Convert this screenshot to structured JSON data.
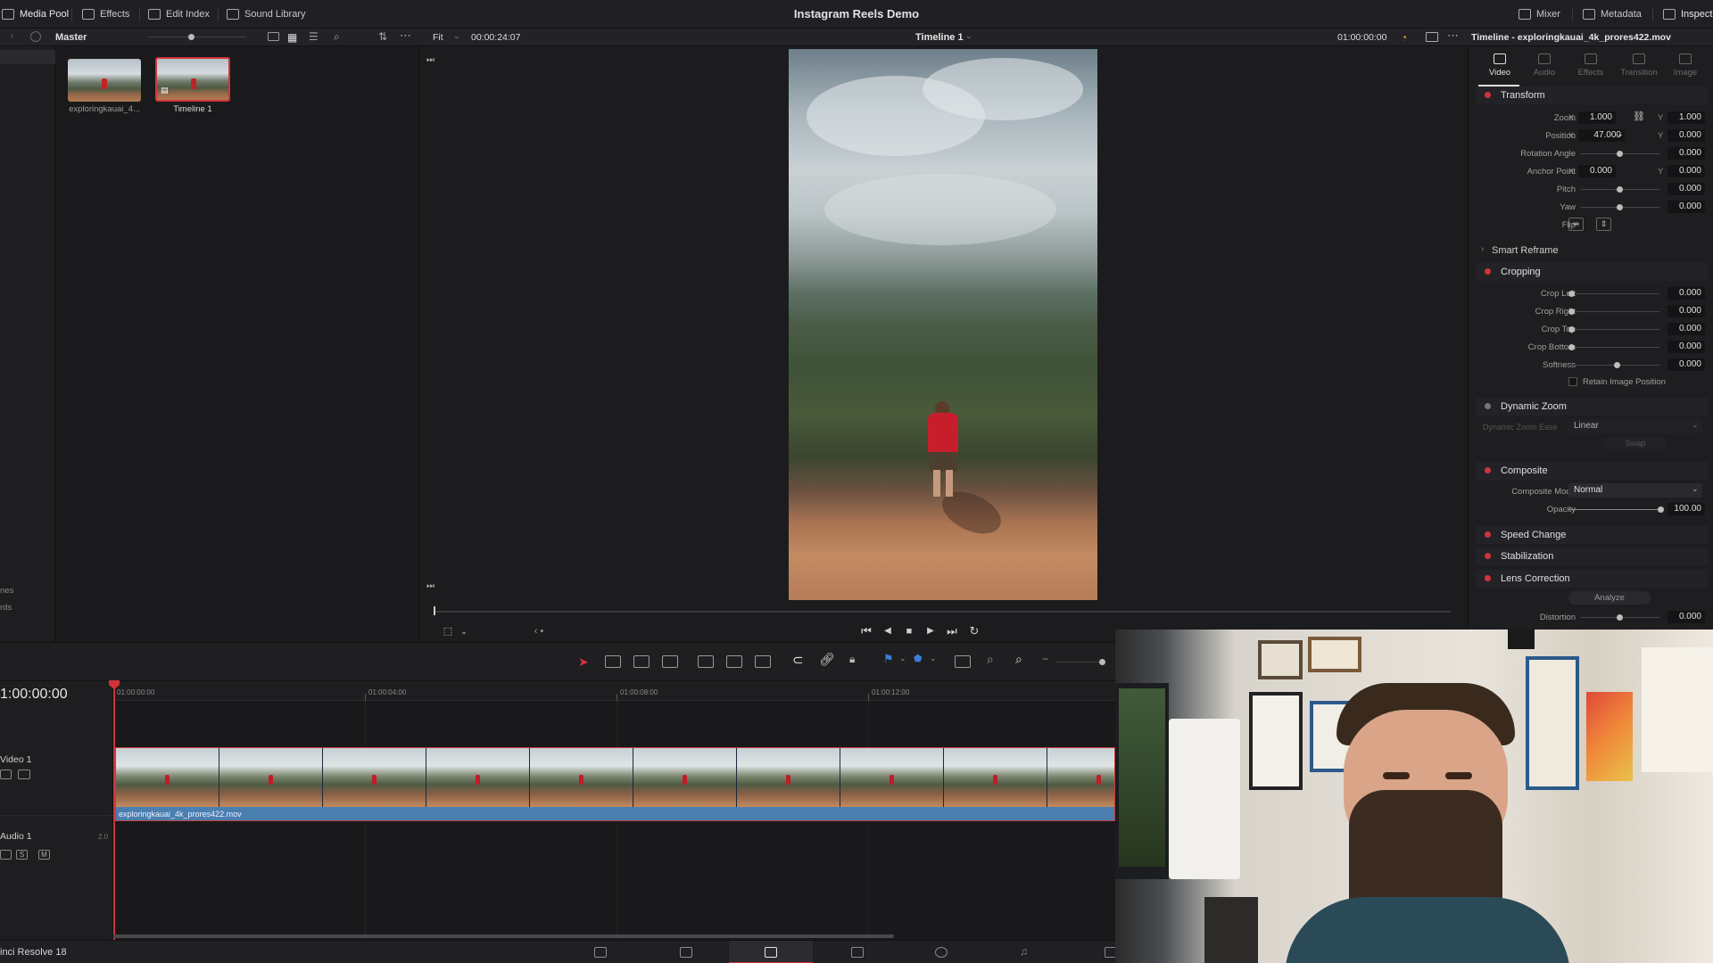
{
  "topbar": {
    "media_pool": "Media Pool",
    "effects": "Effects",
    "edit_index": "Edit Index",
    "sound_library": "Sound Library",
    "project_title": "Instagram Reels Demo",
    "mixer": "Mixer",
    "metadata": "Metadata",
    "inspector": "Inspector"
  },
  "media_pool": {
    "bin_name": "Master",
    "items": [
      {
        "name": "exploringkauai_4..."
      },
      {
        "name": "Timeline 1"
      }
    ],
    "sidebar_partial": [
      "nes",
      "rds"
    ]
  },
  "viewer": {
    "fit": "Fit",
    "duration": "00:00:24:07",
    "timeline_name": "Timeline 1",
    "timecode": "01:00:00:00"
  },
  "inspector": {
    "title": "Timeline - exploringkauai_4k_prores422.mov",
    "tabs": [
      "Video",
      "Audio",
      "Effects",
      "Transition",
      "Image"
    ],
    "transform": {
      "title": "Transform",
      "zoom_label": "Zoom",
      "zoom_x": "1.000",
      "zoom_y": "1.000",
      "position_label": "Position",
      "position_x": "47.000",
      "position_y": "0.000",
      "rotation_label": "Rotation Angle",
      "rotation": "0.000",
      "anchor_label": "Anchor Point",
      "anchor_x": "0.000",
      "anchor_y": "0.000",
      "pitch_label": "Pitch",
      "pitch": "0.000",
      "yaw_label": "Yaw",
      "yaw": "0.000",
      "flip_label": "Flip"
    },
    "smart_reframe": "Smart Reframe",
    "cropping": {
      "title": "Cropping",
      "left_label": "Crop Left",
      "left": "0.000",
      "right_label": "Crop Right",
      "right": "0.000",
      "top_label": "Crop Top",
      "top": "0.000",
      "bottom_label": "Crop Bottom",
      "bottom": "0.000",
      "softness_label": "Softness",
      "softness": "0.000",
      "retain": "Retain Image Position"
    },
    "dynamic_zoom": {
      "title": "Dynamic Zoom",
      "ease_label": "Dynamic Zoom Ease",
      "ease": "Linear",
      "swap": "Swap"
    },
    "composite": {
      "title": "Composite",
      "mode_label": "Composite Mode",
      "mode": "Normal",
      "opacity_label": "Opacity",
      "opacity": "100.00"
    },
    "speed_change": "Speed Change",
    "stabilization": "Stabilization",
    "lens_correction": {
      "title": "Lens Correction",
      "analyze": "Analyze",
      "distortion_label": "Distortion",
      "distortion": "0.000"
    }
  },
  "timeline": {
    "timecode": "1:00:00:00",
    "ruler": [
      "01:00:00:00",
      "01:00:04:00",
      "01:00:08:00",
      "01:00:12:00"
    ],
    "video_track": "Video 1",
    "audio_track": "Audio 1",
    "audio_channel": "2.0",
    "clip_name": "exploringkauai_4k_prores422.mov",
    "solo": "S",
    "mute": "M"
  },
  "footer": {
    "app_version": "inci Resolve 18"
  },
  "colors": {
    "accent_red": "#d2333b",
    "clip_blue": "#4a7fb0"
  }
}
